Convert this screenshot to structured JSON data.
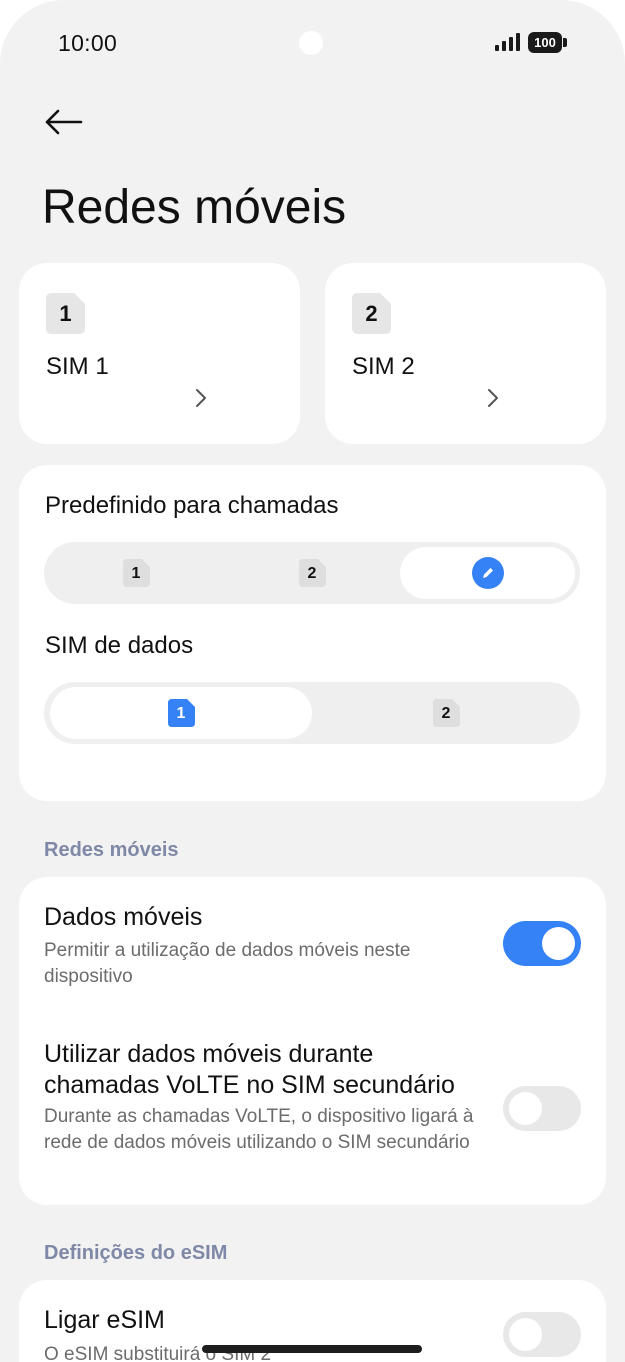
{
  "status_bar": {
    "time": "10:00",
    "battery": "100"
  },
  "header": {
    "title": "Redes móveis"
  },
  "sim_cards": [
    {
      "badge": "1",
      "label": "SIM 1"
    },
    {
      "badge": "2",
      "label": "SIM 2"
    }
  ],
  "calls": {
    "label": "Predefinido para chamadas",
    "options": [
      "1",
      "2"
    ],
    "selected_icon": "edit-icon"
  },
  "data_sim": {
    "label": "SIM de dados",
    "options": [
      "1",
      "2"
    ],
    "selected": "1"
  },
  "mobile_networks": {
    "header": "Redes móveis",
    "mobile_data": {
      "title": "Dados móveis",
      "description": "Permitir a utilização de dados móveis neste dispositivo",
      "enabled": true
    },
    "volte_data": {
      "title": "Utilizar dados móveis durante chamadas VoLTE no SIM secundário",
      "description": "Durante as chamadas VoLTE, o dispositivo ligará à rede de dados móveis utilizando o SIM secundário",
      "enabled": false
    }
  },
  "esim": {
    "header": "Definições do eSIM",
    "enable": {
      "title": "Ligar eSIM",
      "description": "O eSIM substituirá o SIM 2",
      "enabled": false
    }
  },
  "colors": {
    "accent": "#3482f6",
    "background": "#f2f2f2",
    "group_header": "#7f88a6"
  }
}
